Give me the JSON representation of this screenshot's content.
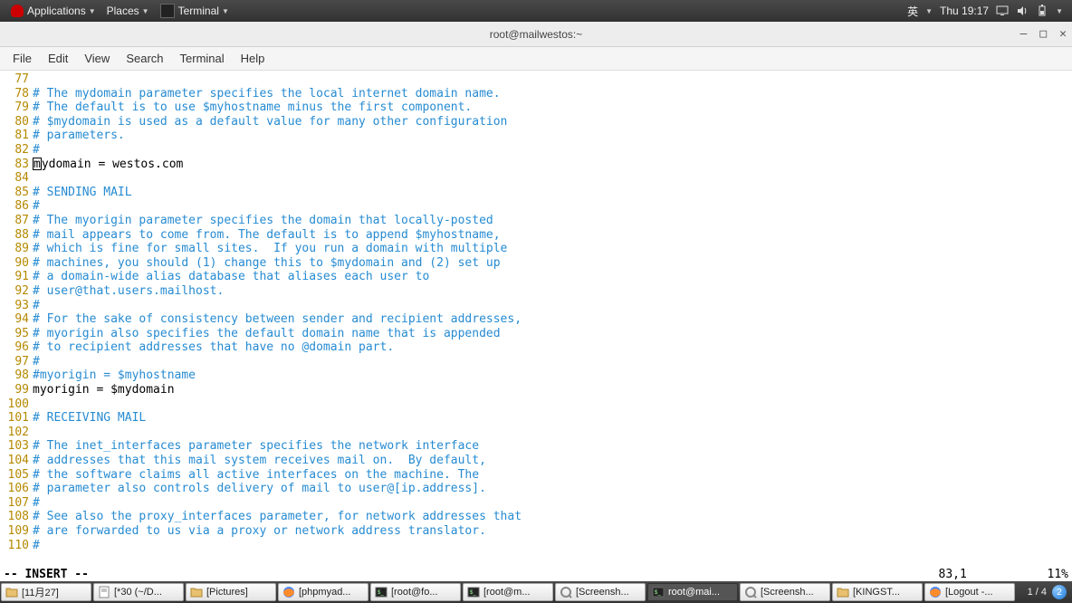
{
  "top_panel": {
    "applications": "Applications",
    "places": "Places",
    "terminal": "Terminal",
    "ime": "英",
    "clock": "Thu 19:17"
  },
  "window": {
    "title": "root@mailwestos:~",
    "menus": [
      "File",
      "Edit",
      "View",
      "Search",
      "Terminal",
      "Help"
    ]
  },
  "lines": [
    {
      "n": "77",
      "cls": "ln-only",
      "text": ""
    },
    {
      "n": "78",
      "cls": "cm",
      "text": "# The mydomain parameter specifies the local internet domain name."
    },
    {
      "n": "79",
      "cls": "cm",
      "text": "# The default is to use $myhostname minus the first component."
    },
    {
      "n": "80",
      "cls": "cm",
      "text": "# $mydomain is used as a default value for many other configuration"
    },
    {
      "n": "81",
      "cls": "cm",
      "text": "# parameters."
    },
    {
      "n": "82",
      "cls": "cm",
      "text": "#"
    },
    {
      "n": "83",
      "cls": "cursor",
      "pre": "",
      "boxed": "m",
      "post": "ydomain = westos.com"
    },
    {
      "n": "84",
      "cls": "ln-only",
      "text": ""
    },
    {
      "n": "85",
      "cls": "cm",
      "text": "# SENDING MAIL"
    },
    {
      "n": "86",
      "cls": "cm",
      "text": "#"
    },
    {
      "n": "87",
      "cls": "cm",
      "text": "# The myorigin parameter specifies the domain that locally-posted"
    },
    {
      "n": "88",
      "cls": "cm",
      "text": "# mail appears to come from. The default is to append $myhostname,"
    },
    {
      "n": "89",
      "cls": "cm",
      "text": "# which is fine for small sites.  If you run a domain with multiple"
    },
    {
      "n": "90",
      "cls": "cm",
      "text": "# machines, you should (1) change this to $mydomain and (2) set up"
    },
    {
      "n": "91",
      "cls": "cm",
      "text": "# a domain-wide alias database that aliases each user to"
    },
    {
      "n": "92",
      "cls": "cm",
      "text": "# user@that.users.mailhost."
    },
    {
      "n": "93",
      "cls": "cm",
      "text": "#"
    },
    {
      "n": "94",
      "cls": "cm",
      "text": "# For the sake of consistency between sender and recipient addresses,"
    },
    {
      "n": "95",
      "cls": "cm",
      "text": "# myorigin also specifies the default domain name that is appended"
    },
    {
      "n": "96",
      "cls": "cm",
      "text": "# to recipient addresses that have no @domain part."
    },
    {
      "n": "97",
      "cls": "cm",
      "text": "#"
    },
    {
      "n": "98",
      "cls": "cm",
      "text": "#myorigin = $myhostname"
    },
    {
      "n": "99",
      "cls": "tx",
      "text": "myorigin = $mydomain"
    },
    {
      "n": "100",
      "cls": "ln-only",
      "text": ""
    },
    {
      "n": "101",
      "cls": "cm",
      "text": "# RECEIVING MAIL"
    },
    {
      "n": "102",
      "cls": "ln-only",
      "text": ""
    },
    {
      "n": "103",
      "cls": "cm",
      "text": "# The inet_interfaces parameter specifies the network interface"
    },
    {
      "n": "104",
      "cls": "cm",
      "text": "# addresses that this mail system receives mail on.  By default,"
    },
    {
      "n": "105",
      "cls": "cm",
      "text": "# the software claims all active interfaces on the machine. The"
    },
    {
      "n": "106",
      "cls": "cm",
      "text": "# parameter also controls delivery of mail to user@[ip.address]."
    },
    {
      "n": "107",
      "cls": "cm",
      "text": "#"
    },
    {
      "n": "108",
      "cls": "cm",
      "text": "# See also the proxy_interfaces parameter, for network addresses that"
    },
    {
      "n": "109",
      "cls": "cm",
      "text": "# are forwarded to us via a proxy or network address translator."
    },
    {
      "n": "110",
      "cls": "cm",
      "text": "#"
    }
  ],
  "status": {
    "mode": "-- INSERT --",
    "pos": "83,1",
    "pct": "11%"
  },
  "tasks": [
    {
      "icon": "folder",
      "label": "[11月27]",
      "active": false
    },
    {
      "icon": "gedit",
      "label": "[*30 (~/D...",
      "active": false
    },
    {
      "icon": "folder",
      "label": "[Pictures]",
      "active": false
    },
    {
      "icon": "firefox",
      "label": "[phpmyad...",
      "active": false
    },
    {
      "icon": "term",
      "label": "[root@fo...",
      "active": false
    },
    {
      "icon": "term",
      "label": "[root@m...",
      "active": false
    },
    {
      "icon": "eye",
      "label": "[Screensh...",
      "active": false
    },
    {
      "icon": "term",
      "label": "root@mai...",
      "active": true
    },
    {
      "icon": "eye",
      "label": "[Screensh...",
      "active": false
    },
    {
      "icon": "folder",
      "label": "[KINGST...",
      "active": false
    },
    {
      "icon": "firefox",
      "label": "[Logout -...",
      "active": false
    }
  ],
  "workspace": {
    "label": "1 / 4",
    "badge": "2"
  }
}
